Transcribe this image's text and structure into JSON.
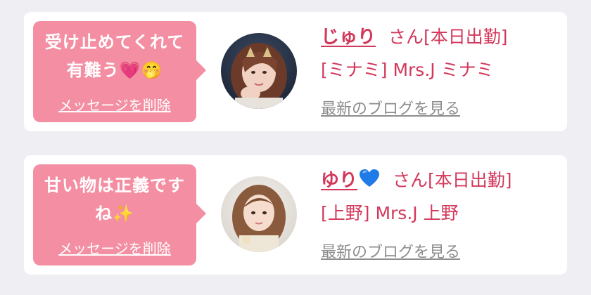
{
  "colors": {
    "accent": "#d3385b",
    "bubble": "#f48fa3",
    "background": "#efeef2",
    "muted": "#8d8d8d"
  },
  "cards": [
    {
      "message": "受け止めてくれて有難う💗🤭",
      "delete_label": "メッセージを削除",
      "name": "じゅり",
      "san": "さん",
      "status": "[本日出勤]",
      "shop": "[ミナミ] Mrs.J ミナミ",
      "blog_label": "最新のブログを見る"
    },
    {
      "message": "甘い物は正義ですね✨",
      "delete_label": "メッセージを削除",
      "name": "ゆり",
      "name_icon": "blue-heart-icon",
      "san": "さん",
      "status": "[本日出勤]",
      "shop": "[上野] Mrs.J 上野",
      "blog_label": "最新のブログを見る"
    }
  ]
}
